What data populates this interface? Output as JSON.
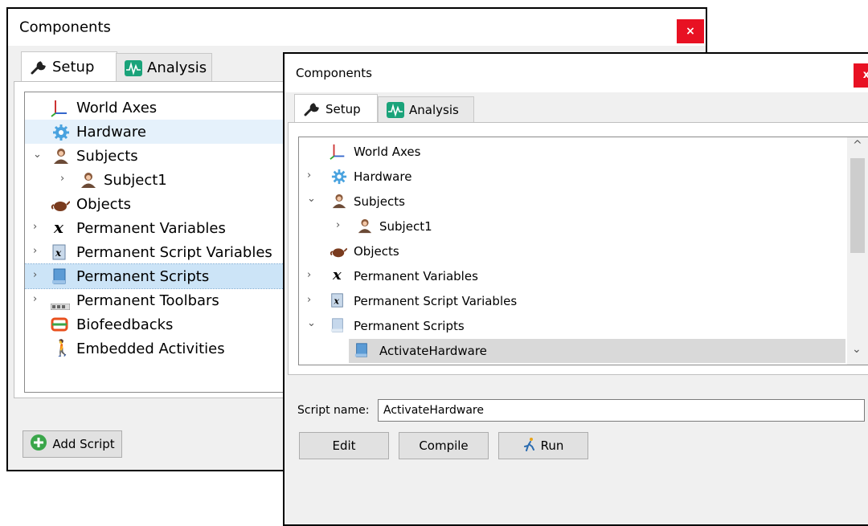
{
  "back_window": {
    "title": "Components",
    "close_label": "×",
    "tabs": [
      {
        "label": "Setup",
        "icon": "wrench-icon"
      },
      {
        "label": "Analysis",
        "icon": "waveform-icon"
      }
    ],
    "tree": [
      {
        "label": "World Axes",
        "icon": "axes-icon"
      },
      {
        "label": "Hardware",
        "icon": "gear-icon"
      },
      {
        "label": "Subjects",
        "icon": "person-icon"
      },
      {
        "label": "Subject1",
        "icon": "person-icon"
      },
      {
        "label": "Objects",
        "icon": "teapot-icon"
      },
      {
        "label": "Permanent Variables",
        "icon": "variable-x-icon"
      },
      {
        "label": "Permanent Script Variables",
        "icon": "script-variable-icon"
      },
      {
        "label": "Permanent Scripts",
        "icon": "script-icon"
      },
      {
        "label": "Permanent Toolbars",
        "icon": "toolbar-icon"
      },
      {
        "label": "Biofeedbacks",
        "icon": "feedback-loop-icon"
      },
      {
        "label": "Embedded Activities",
        "icon": "walking-person-icon"
      }
    ],
    "add_button_label": "Add Script"
  },
  "front_window": {
    "title": "Components",
    "close_label": "x",
    "tabs": [
      {
        "label": "Setup",
        "icon": "wrench-icon"
      },
      {
        "label": "Analysis",
        "icon": "waveform-icon"
      }
    ],
    "tree": [
      {
        "label": "World Axes",
        "icon": "axes-icon"
      },
      {
        "label": "Hardware",
        "icon": "gear-icon"
      },
      {
        "label": "Subjects",
        "icon": "person-icon"
      },
      {
        "label": "Subject1",
        "icon": "person-icon"
      },
      {
        "label": "Objects",
        "icon": "teapot-icon"
      },
      {
        "label": "Permanent Variables",
        "icon": "variable-x-icon"
      },
      {
        "label": "Permanent Script Variables",
        "icon": "script-variable-icon"
      },
      {
        "label": "Permanent Scripts",
        "icon": "script-icon"
      },
      {
        "label": "ActivateHardware",
        "icon": "script-icon"
      }
    ],
    "script_name_label": "Script name:",
    "script_name_value": "ActivateHardware",
    "buttons": {
      "edit": "Edit",
      "compile": "Compile",
      "run": "Run"
    }
  },
  "colors": {
    "close_red": "#e81123",
    "selection_blue": "#cce4f7",
    "hover_blue": "#e5f1fb",
    "selection_gray": "#d9d9d9"
  }
}
